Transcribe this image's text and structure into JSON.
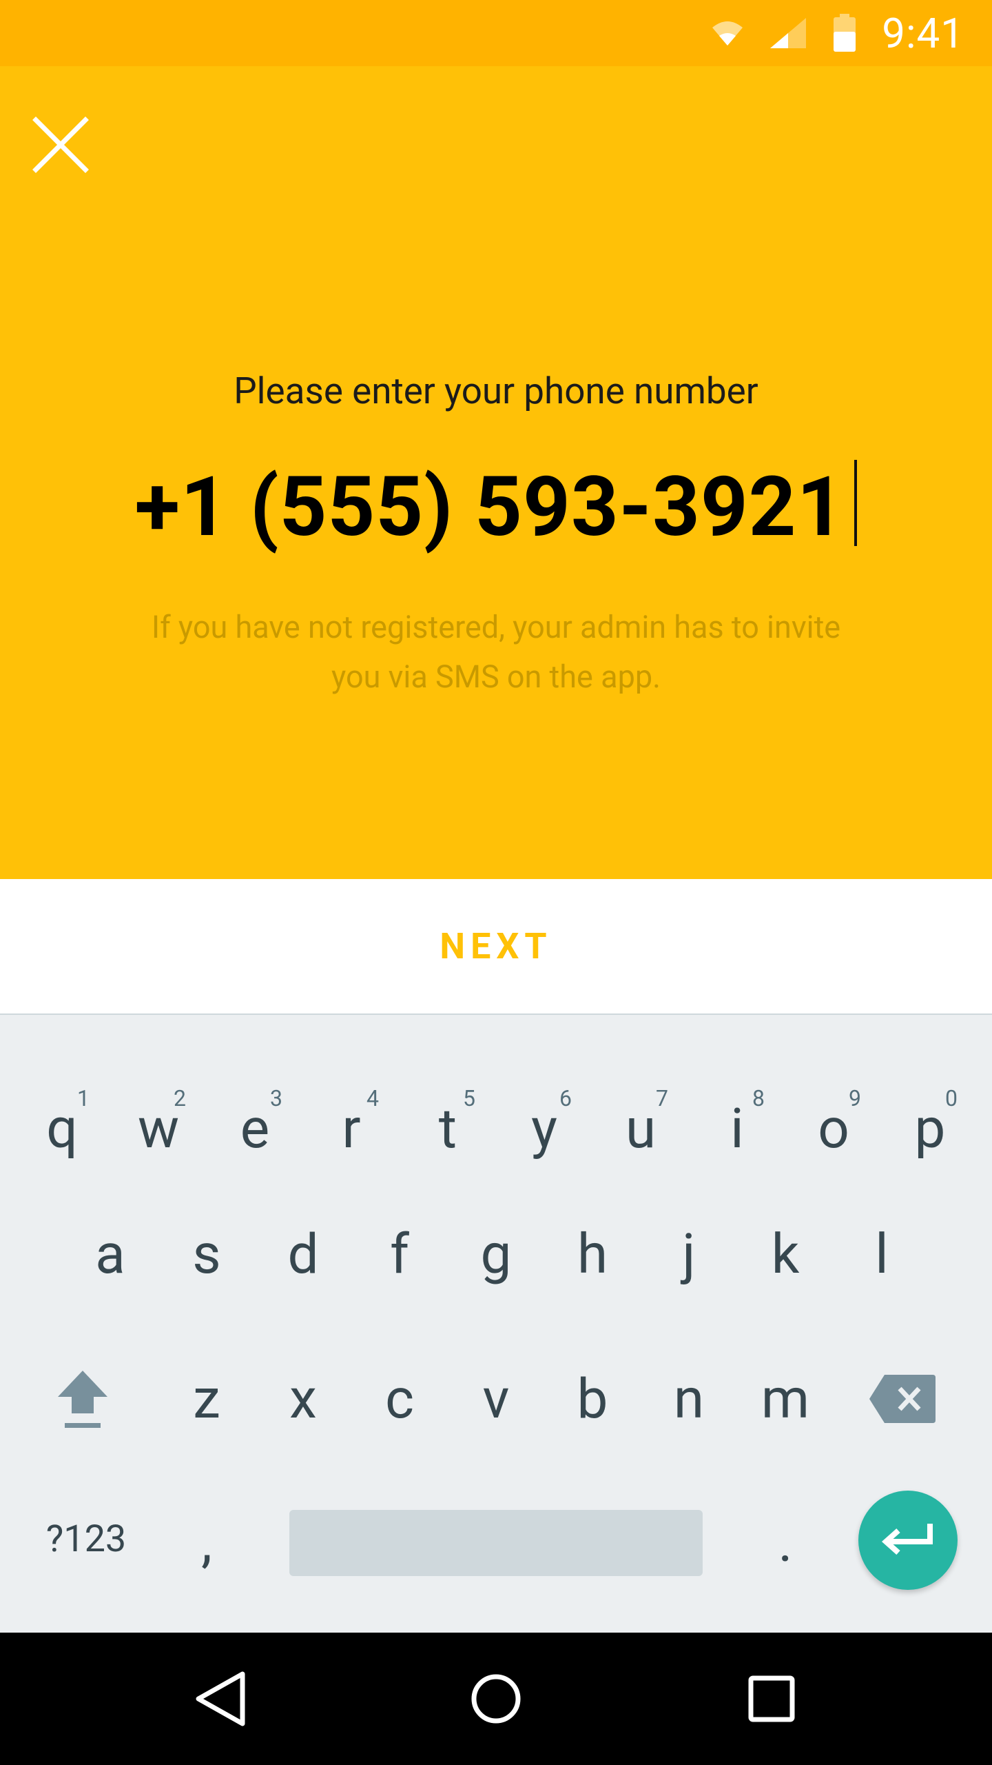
{
  "colors": {
    "status_bar": "#FFB300",
    "hero_background": "#FFC107",
    "accent": "#FFC107",
    "hint_text": "#C99A00",
    "keyboard_background": "#ECEFF1",
    "enter_key": "#26B5A3"
  },
  "status_bar": {
    "time": "9:41",
    "icons": [
      "wifi-icon",
      "cell-signal-icon",
      "battery-icon"
    ]
  },
  "header": {
    "close_icon": "close-icon"
  },
  "form": {
    "prompt": "Please enter your phone number",
    "phone_value": "+1 (555) 593-3921",
    "hint": "If you have not registered, your admin has to invite you via SMS on the app."
  },
  "actions": {
    "next_label": "NEXT"
  },
  "keyboard": {
    "row1": [
      {
        "key": "q",
        "num": "1"
      },
      {
        "key": "w",
        "num": "2"
      },
      {
        "key": "e",
        "num": "3"
      },
      {
        "key": "r",
        "num": "4"
      },
      {
        "key": "t",
        "num": "5"
      },
      {
        "key": "y",
        "num": "6"
      },
      {
        "key": "u",
        "num": "7"
      },
      {
        "key": "i",
        "num": "8"
      },
      {
        "key": "o",
        "num": "9"
      },
      {
        "key": "p",
        "num": "0"
      }
    ],
    "row2": [
      "a",
      "s",
      "d",
      "f",
      "g",
      "h",
      "j",
      "k",
      "l"
    ],
    "row3": [
      "z",
      "x",
      "c",
      "v",
      "b",
      "n",
      "m"
    ],
    "symbols_label": "?123",
    "comma": ",",
    "period": "."
  },
  "nav": {
    "icons": [
      "back-icon",
      "home-icon",
      "recents-icon"
    ]
  }
}
